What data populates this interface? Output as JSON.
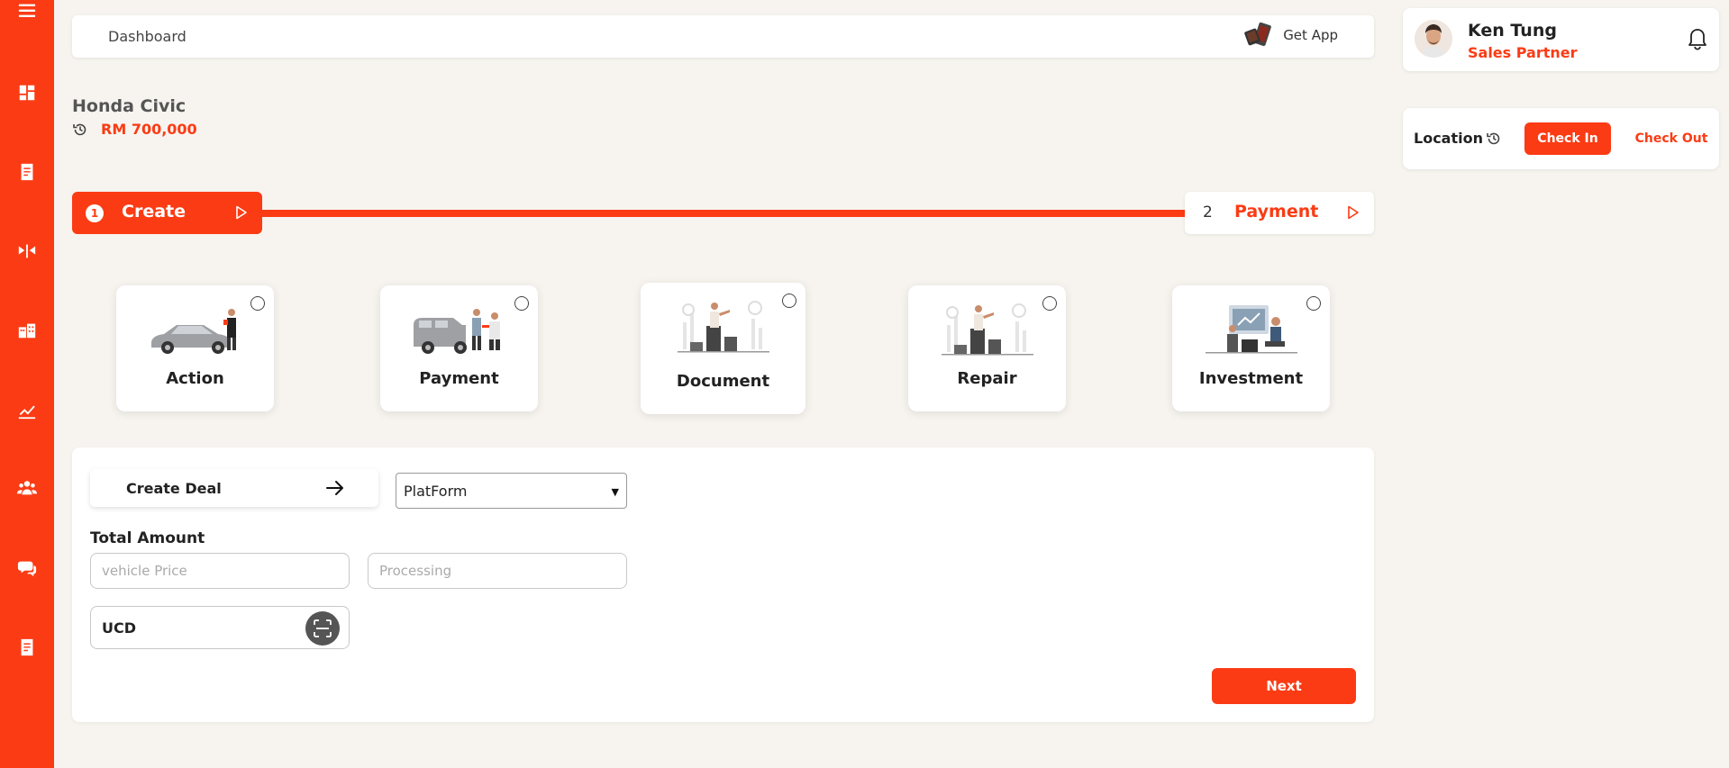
{
  "colors": {
    "accent": "#fb3b14",
    "background": "#f7f4ef",
    "card": "#ffffff"
  },
  "sidebar": {
    "items": [
      {
        "icon": "hamburger-menu-icon"
      },
      {
        "icon": "dashboard-icon"
      },
      {
        "icon": "document-icon"
      },
      {
        "icon": "car-service-icon"
      },
      {
        "icon": "building-icon"
      },
      {
        "icon": "growth-chart-icon"
      },
      {
        "icon": "team-icon"
      },
      {
        "icon": "chat-icon"
      },
      {
        "icon": "report-icon"
      }
    ]
  },
  "topbar": {
    "breadcrumb": "Dashboard",
    "get_app_label": "Get App"
  },
  "profile": {
    "name": "Ken Tung",
    "role": "Sales Partner"
  },
  "location": {
    "label": "Location",
    "check_in": "Check In",
    "check_out": "Check Out"
  },
  "car": {
    "title": "Honda Civic",
    "price": "RM 700,000"
  },
  "stepper": {
    "steps": [
      {
        "number": "1",
        "label": "Create",
        "active": true
      },
      {
        "number": "2",
        "label": "Payment",
        "active": false
      }
    ]
  },
  "categories": [
    {
      "label": "Action",
      "icon": "car-action-illustration"
    },
    {
      "label": "Payment",
      "icon": "car-payment-illustration"
    },
    {
      "label": "Document",
      "icon": "document-illustration"
    },
    {
      "label": "Repair",
      "icon": "repair-illustration"
    },
    {
      "label": "Investment",
      "icon": "investment-illustration"
    }
  ],
  "form": {
    "create_deal_label": "Create Deal",
    "platform_value": "PlatForm",
    "total_amount_label": "Total Amount",
    "vehicle_price_placeholder": "vehicle Price",
    "processing_placeholder": "Processing",
    "ucd_value": "UCD",
    "next_label": "Next"
  }
}
